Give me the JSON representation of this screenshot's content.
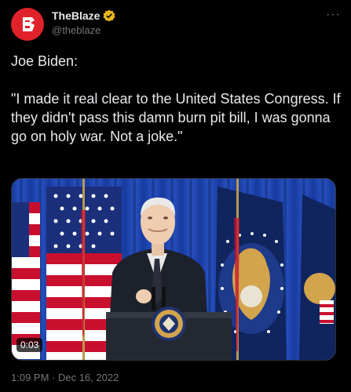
{
  "account": {
    "display_name": "TheBlaze",
    "handle": "@theblaze",
    "avatar_icon": "theblaze-logo-icon",
    "verified_icon": "verified-badge-icon",
    "brand_color": "#e0222b"
  },
  "tweet": {
    "line1": "Joe Biden:",
    "line2": "\"I made it real clear to the United States Congress. If they didn't pass this damn burn pit bill, I was gonna go on holy war. Not a joke.\"",
    "timestamp": "1:09 PM · Dec 16, 2022"
  },
  "media": {
    "type": "video",
    "duration": "0:03"
  },
  "menu_icon": "more-options-icon"
}
